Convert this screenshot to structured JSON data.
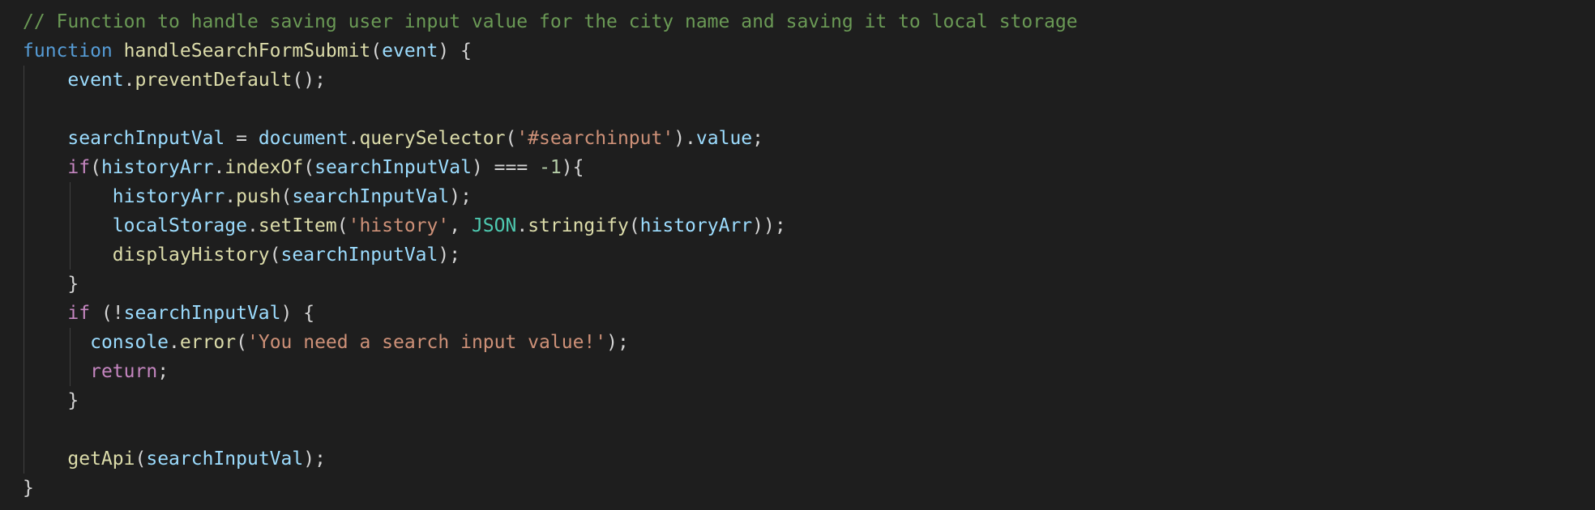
{
  "editor": {
    "language": "javascript",
    "theme": {
      "background": "#1e1e1e",
      "indent_guide": "#404040"
    },
    "colors": {
      "comment": "#6a9955",
      "keyword": "#569cd6",
      "control": "#c586c0",
      "function": "#dcdcaa",
      "variable": "#9cdcfe",
      "string": "#ce9178",
      "number": "#b5cea8",
      "class": "#4ec9b0",
      "punct": "#d4d4d4"
    },
    "lines": [
      [
        [
          "// Function to handle saving user input value for the city name and saving it to local storage",
          "comment"
        ]
      ],
      [
        [
          "function",
          "keyword"
        ],
        [
          " ",
          "punct"
        ],
        [
          "handleSearchFormSubmit",
          "function"
        ],
        [
          "(",
          "punct"
        ],
        [
          "event",
          "variable"
        ],
        [
          ") {",
          "punct"
        ]
      ],
      [
        [
          "    ",
          "punct"
        ],
        [
          "event",
          "variable"
        ],
        [
          ".",
          "punct"
        ],
        [
          "preventDefault",
          "function"
        ],
        [
          "();",
          "punct"
        ]
      ],
      [],
      [
        [
          "    ",
          "punct"
        ],
        [
          "searchInputVal",
          "variable"
        ],
        [
          " = ",
          "punct"
        ],
        [
          "document",
          "variable"
        ],
        [
          ".",
          "punct"
        ],
        [
          "querySelector",
          "function"
        ],
        [
          "(",
          "punct"
        ],
        [
          "'#searchinput'",
          "string"
        ],
        [
          ").",
          "punct"
        ],
        [
          "value",
          "variable"
        ],
        [
          ";",
          "punct"
        ]
      ],
      [
        [
          "    ",
          "punct"
        ],
        [
          "if",
          "control"
        ],
        [
          "(",
          "punct"
        ],
        [
          "historyArr",
          "variable"
        ],
        [
          ".",
          "punct"
        ],
        [
          "indexOf",
          "function"
        ],
        [
          "(",
          "punct"
        ],
        [
          "searchInputVal",
          "variable"
        ],
        [
          ") === ",
          "punct"
        ],
        [
          "-1",
          "number"
        ],
        [
          "){",
          "punct"
        ]
      ],
      [
        [
          "        ",
          "punct"
        ],
        [
          "historyArr",
          "variable"
        ],
        [
          ".",
          "punct"
        ],
        [
          "push",
          "function"
        ],
        [
          "(",
          "punct"
        ],
        [
          "searchInputVal",
          "variable"
        ],
        [
          ");",
          "punct"
        ]
      ],
      [
        [
          "        ",
          "punct"
        ],
        [
          "localStorage",
          "variable"
        ],
        [
          ".",
          "punct"
        ],
        [
          "setItem",
          "function"
        ],
        [
          "(",
          "punct"
        ],
        [
          "'history'",
          "string"
        ],
        [
          ", ",
          "punct"
        ],
        [
          "JSON",
          "class"
        ],
        [
          ".",
          "punct"
        ],
        [
          "stringify",
          "function"
        ],
        [
          "(",
          "punct"
        ],
        [
          "historyArr",
          "variable"
        ],
        [
          "));",
          "punct"
        ]
      ],
      [
        [
          "        ",
          "punct"
        ],
        [
          "displayHistory",
          "function"
        ],
        [
          "(",
          "punct"
        ],
        [
          "searchInputVal",
          "variable"
        ],
        [
          ");",
          "punct"
        ]
      ],
      [
        [
          "    ",
          "punct"
        ],
        [
          "}",
          "punct"
        ]
      ],
      [
        [
          "    ",
          "punct"
        ],
        [
          "if",
          "control"
        ],
        [
          " (!",
          "punct"
        ],
        [
          "searchInputVal",
          "variable"
        ],
        [
          ") {",
          "punct"
        ]
      ],
      [
        [
          "      ",
          "punct"
        ],
        [
          "console",
          "variable"
        ],
        [
          ".",
          "punct"
        ],
        [
          "error",
          "function"
        ],
        [
          "(",
          "punct"
        ],
        [
          "'You need a search input value!'",
          "string"
        ],
        [
          ");",
          "punct"
        ]
      ],
      [
        [
          "      ",
          "punct"
        ],
        [
          "return",
          "control"
        ],
        [
          ";",
          "punct"
        ]
      ],
      [
        [
          "    ",
          "punct"
        ],
        [
          "}",
          "punct"
        ]
      ],
      [],
      [
        [
          "    ",
          "punct"
        ],
        [
          "getApi",
          "function"
        ],
        [
          "(",
          "punct"
        ],
        [
          "searchInputVal",
          "variable"
        ],
        [
          ");",
          "punct"
        ]
      ],
      [
        [
          "}",
          "punct"
        ]
      ]
    ]
  }
}
